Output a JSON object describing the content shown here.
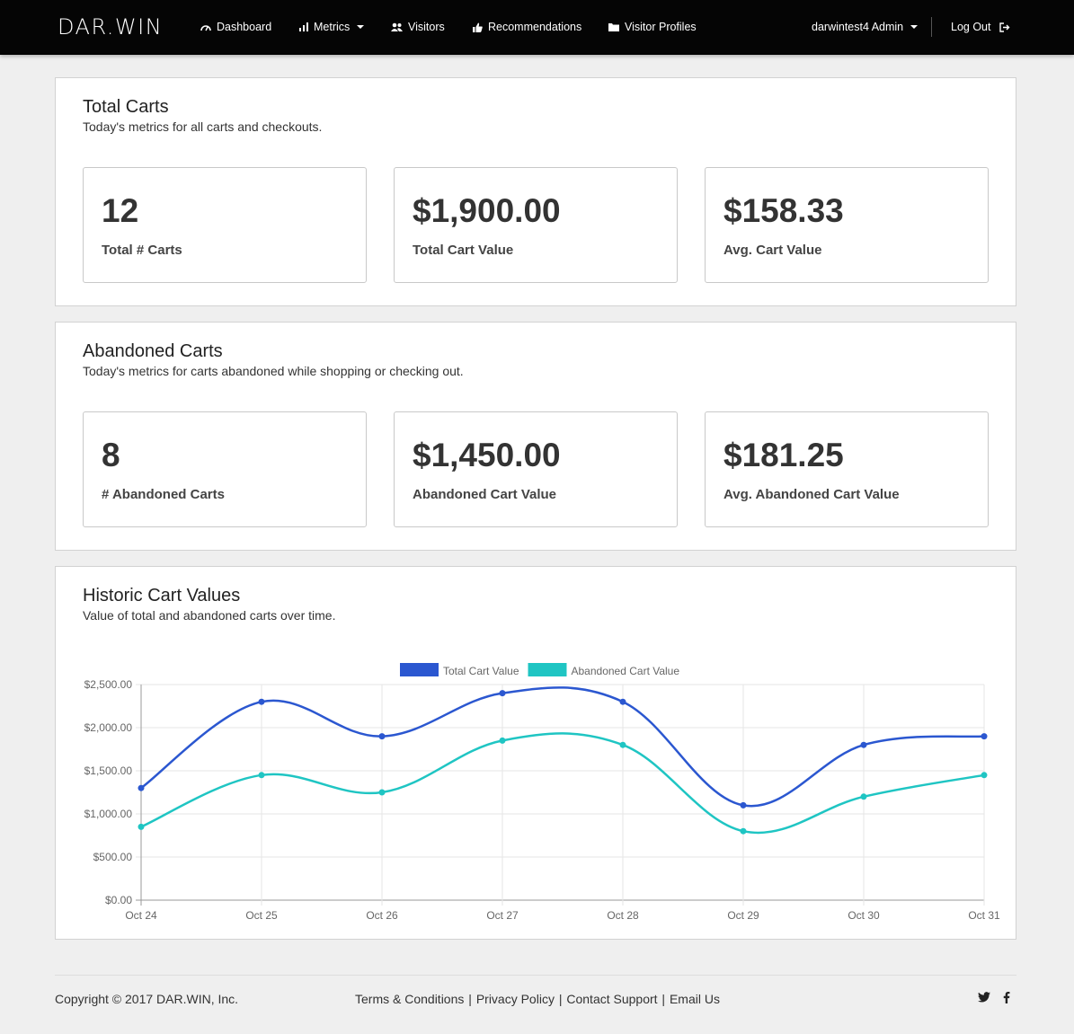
{
  "nav": {
    "brand": "DAR.WIN",
    "items": [
      {
        "label": "Dashboard"
      },
      {
        "label": "Metrics"
      },
      {
        "label": "Visitors"
      },
      {
        "label": "Recommendations"
      },
      {
        "label": "Visitor Profiles"
      }
    ],
    "user": "darwintest4 Admin",
    "logout": "Log Out"
  },
  "total_carts": {
    "title": "Total Carts",
    "subtitle": "Today's metrics for all carts and checkouts.",
    "stats": [
      {
        "value": "12",
        "label": "Total # Carts"
      },
      {
        "value": "$1,900.00",
        "label": "Total Cart Value"
      },
      {
        "value": "$158.33",
        "label": "Avg. Cart Value"
      }
    ]
  },
  "abandoned_carts": {
    "title": "Abandoned Carts",
    "subtitle": "Today's metrics for carts abandoned while shopping or checking out.",
    "stats": [
      {
        "value": "8",
        "label": "# Abandoned Carts"
      },
      {
        "value": "$1,450.00",
        "label": "Abandoned Cart Value"
      },
      {
        "value": "$181.25",
        "label": "Avg. Abandoned Cart Value"
      }
    ]
  },
  "historic": {
    "title": "Historic Cart Values",
    "subtitle": "Value of total and abandoned carts over time."
  },
  "chart_data": {
    "type": "line",
    "title": "",
    "xlabel": "",
    "ylabel": "",
    "categories": [
      "Oct 24",
      "Oct 25",
      "Oct 26",
      "Oct 27",
      "Oct 28",
      "Oct 29",
      "Oct 30",
      "Oct 31"
    ],
    "series": [
      {
        "name": "Total Cart Value",
        "color": "#2b57d0",
        "values": [
          1300,
          2300,
          1900,
          2400,
          2300,
          1100,
          1800,
          1900
        ]
      },
      {
        "name": "Abandoned Cart Value",
        "color": "#1fc5c3",
        "values": [
          850,
          1450,
          1250,
          1850,
          1800,
          800,
          1200,
          1450
        ]
      }
    ],
    "ylim": [
      0,
      2500
    ],
    "yticks": [
      0,
      500,
      1000,
      1500,
      2000,
      2500
    ],
    "ytick_labels": [
      "$0.00",
      "$500.00",
      "$1,000.00",
      "$1,500.00",
      "$2,000.00",
      "$2,500.00"
    ],
    "grid": true,
    "legend": "top-center"
  },
  "footer": {
    "copyright": "Copyright © 2017 DAR.WIN, Inc.",
    "links": [
      "Terms & Conditions",
      "Privacy Policy",
      "Contact Support",
      "Email Us"
    ],
    "social": [
      "twitter-icon",
      "facebook-icon"
    ]
  }
}
